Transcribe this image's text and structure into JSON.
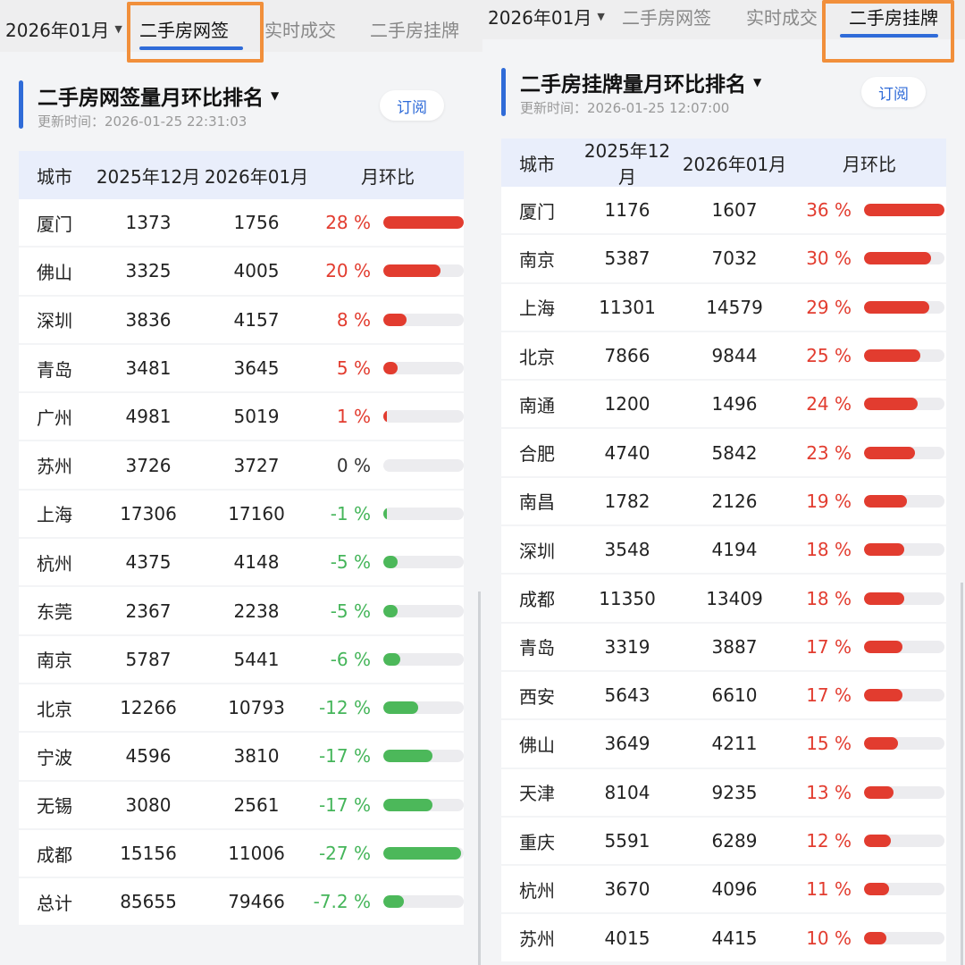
{
  "colors": {
    "accent": "#2f6bd8",
    "highlight": "#f18f3b",
    "positive": "#e23c2f",
    "negative": "#4cb85a"
  },
  "left": {
    "date": "2026年01月",
    "tabs": [
      "二手房网签",
      "实时成交",
      "二手房挂牌"
    ],
    "active_tab": 0,
    "title": "二手房网签量月环比排名",
    "updated": "更新时间：2026-01-25 22:31:03",
    "subscribe": "订阅",
    "columns": [
      "城市",
      "2025年12月",
      "2026年01月",
      "月环比"
    ],
    "bar_max": 28,
    "rows": [
      {
        "city": "厦门",
        "prev": "1373",
        "cur": "1756",
        "pct": "28 %",
        "v": 28
      },
      {
        "city": "佛山",
        "prev": "3325",
        "cur": "4005",
        "pct": "20 %",
        "v": 20
      },
      {
        "city": "深圳",
        "prev": "3836",
        "cur": "4157",
        "pct": "8 %",
        "v": 8
      },
      {
        "city": "青岛",
        "prev": "3481",
        "cur": "3645",
        "pct": "5 %",
        "v": 5
      },
      {
        "city": "广州",
        "prev": "4981",
        "cur": "5019",
        "pct": "1 %",
        "v": 1
      },
      {
        "city": "苏州",
        "prev": "3726",
        "cur": "3727",
        "pct": "0 %",
        "v": 0
      },
      {
        "city": "上海",
        "prev": "17306",
        "cur": "17160",
        "pct": "-1 %",
        "v": -1
      },
      {
        "city": "杭州",
        "prev": "4375",
        "cur": "4148",
        "pct": "-5 %",
        "v": -5
      },
      {
        "city": "东莞",
        "prev": "2367",
        "cur": "2238",
        "pct": "-5 %",
        "v": -5
      },
      {
        "city": "南京",
        "prev": "5787",
        "cur": "5441",
        "pct": "-6 %",
        "v": -6
      },
      {
        "city": "北京",
        "prev": "12266",
        "cur": "10793",
        "pct": "-12 %",
        "v": -12
      },
      {
        "city": "宁波",
        "prev": "4596",
        "cur": "3810",
        "pct": "-17 %",
        "v": -17
      },
      {
        "city": "无锡",
        "prev": "3080",
        "cur": "2561",
        "pct": "-17 %",
        "v": -17
      },
      {
        "city": "成都",
        "prev": "15156",
        "cur": "11006",
        "pct": "-27 %",
        "v": -27
      },
      {
        "city": "总计",
        "prev": "85655",
        "cur": "79466",
        "pct": "-7.2 %",
        "v": -7.2
      }
    ]
  },
  "right": {
    "date": "2026年01月",
    "tabs": [
      "二手房网签",
      "实时成交",
      "二手房挂牌"
    ],
    "active_tab": 2,
    "title": "二手房挂牌量月环比排名",
    "updated": "更新时间：2026-01-25 12:07:00",
    "subscribe": "订阅",
    "columns": [
      "城市",
      "2025年12月",
      "2026年01月",
      "月环比"
    ],
    "bar_max": 36,
    "rows": [
      {
        "city": "厦门",
        "prev": "1176",
        "cur": "1607",
        "pct": "36 %",
        "v": 36
      },
      {
        "city": "南京",
        "prev": "5387",
        "cur": "7032",
        "pct": "30 %",
        "v": 30
      },
      {
        "city": "上海",
        "prev": "11301",
        "cur": "14579",
        "pct": "29 %",
        "v": 29
      },
      {
        "city": "北京",
        "prev": "7866",
        "cur": "9844",
        "pct": "25 %",
        "v": 25
      },
      {
        "city": "南通",
        "prev": "1200",
        "cur": "1496",
        "pct": "24 %",
        "v": 24
      },
      {
        "city": "合肥",
        "prev": "4740",
        "cur": "5842",
        "pct": "23 %",
        "v": 23
      },
      {
        "city": "南昌",
        "prev": "1782",
        "cur": "2126",
        "pct": "19 %",
        "v": 19
      },
      {
        "city": "深圳",
        "prev": "3548",
        "cur": "4194",
        "pct": "18 %",
        "v": 18
      },
      {
        "city": "成都",
        "prev": "11350",
        "cur": "13409",
        "pct": "18 %",
        "v": 18
      },
      {
        "city": "青岛",
        "prev": "3319",
        "cur": "3887",
        "pct": "17 %",
        "v": 17
      },
      {
        "city": "西安",
        "prev": "5643",
        "cur": "6610",
        "pct": "17 %",
        "v": 17
      },
      {
        "city": "佛山",
        "prev": "3649",
        "cur": "4211",
        "pct": "15 %",
        "v": 15
      },
      {
        "city": "天津",
        "prev": "8104",
        "cur": "9235",
        "pct": "13 %",
        "v": 13
      },
      {
        "city": "重庆",
        "prev": "5591",
        "cur": "6289",
        "pct": "12 %",
        "v": 12
      },
      {
        "city": "杭州",
        "prev": "3670",
        "cur": "4096",
        "pct": "11 %",
        "v": 11
      },
      {
        "city": "苏州",
        "prev": "4015",
        "cur": "4415",
        "pct": "10 %",
        "v": 10
      }
    ]
  }
}
